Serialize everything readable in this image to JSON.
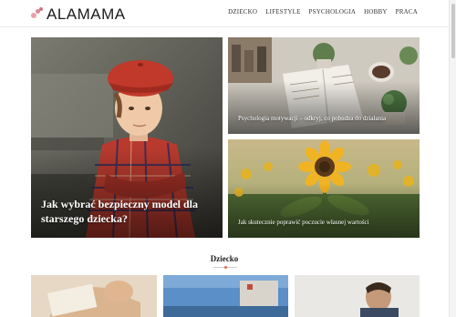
{
  "brand": {
    "name": "ALAMAMA"
  },
  "nav": {
    "items": [
      {
        "label": "DZIECKO"
      },
      {
        "label": "LIFESTYLE"
      },
      {
        "label": "PSYCHOLOGIA"
      },
      {
        "label": "HOBBY"
      },
      {
        "label": "PRACA"
      }
    ]
  },
  "hero": {
    "main": {
      "title": "Jak wybrać bezpieczny model dla starszego dziecka?"
    },
    "top_right": {
      "title": "Psychologia motywacji – odkryj, co pobudza do działania"
    },
    "bottom_right": {
      "title": "Jak skutecznie poprawić poczucie własnej wartości"
    }
  },
  "section": {
    "title": "Dziecko"
  },
  "colors": {
    "accent": "#e36a4a",
    "logo_pink": "#e8a0a8"
  }
}
